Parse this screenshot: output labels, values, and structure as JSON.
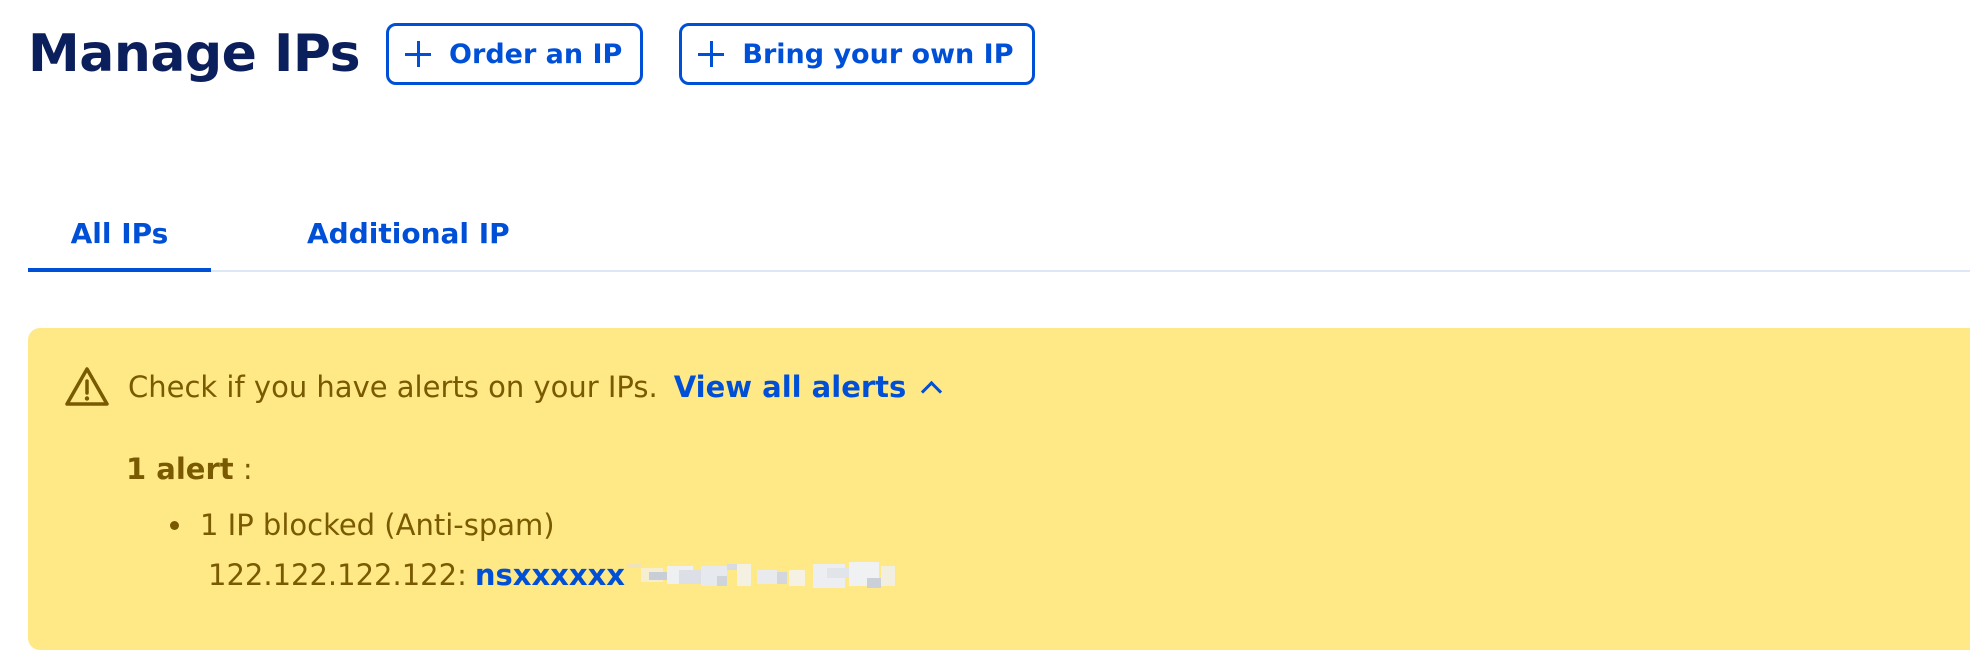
{
  "header": {
    "title": "Manage IPs",
    "order_button_label": "Order an IP",
    "byoip_button_label": "Bring your own IP"
  },
  "tabs": [
    {
      "label": "All IPs",
      "active": true
    },
    {
      "label": "Additional IP",
      "active": false
    }
  ],
  "alert": {
    "message": "Check if you have alerts on your IPs.",
    "view_all_label": "View all alerts",
    "count_label": "1 alert",
    "count_suffix": " :",
    "items": [
      {
        "label": "1 IP blocked (Anti-spam)"
      }
    ],
    "detail": {
      "ip": "122.122.122.122",
      "separator": " :",
      "server": "nsxxxxxx"
    }
  },
  "colors": {
    "brand_blue": "#0050d7",
    "title_navy": "#0b1f5c",
    "warning_bg": "#ffe886",
    "warning_text": "#7a5a00"
  }
}
